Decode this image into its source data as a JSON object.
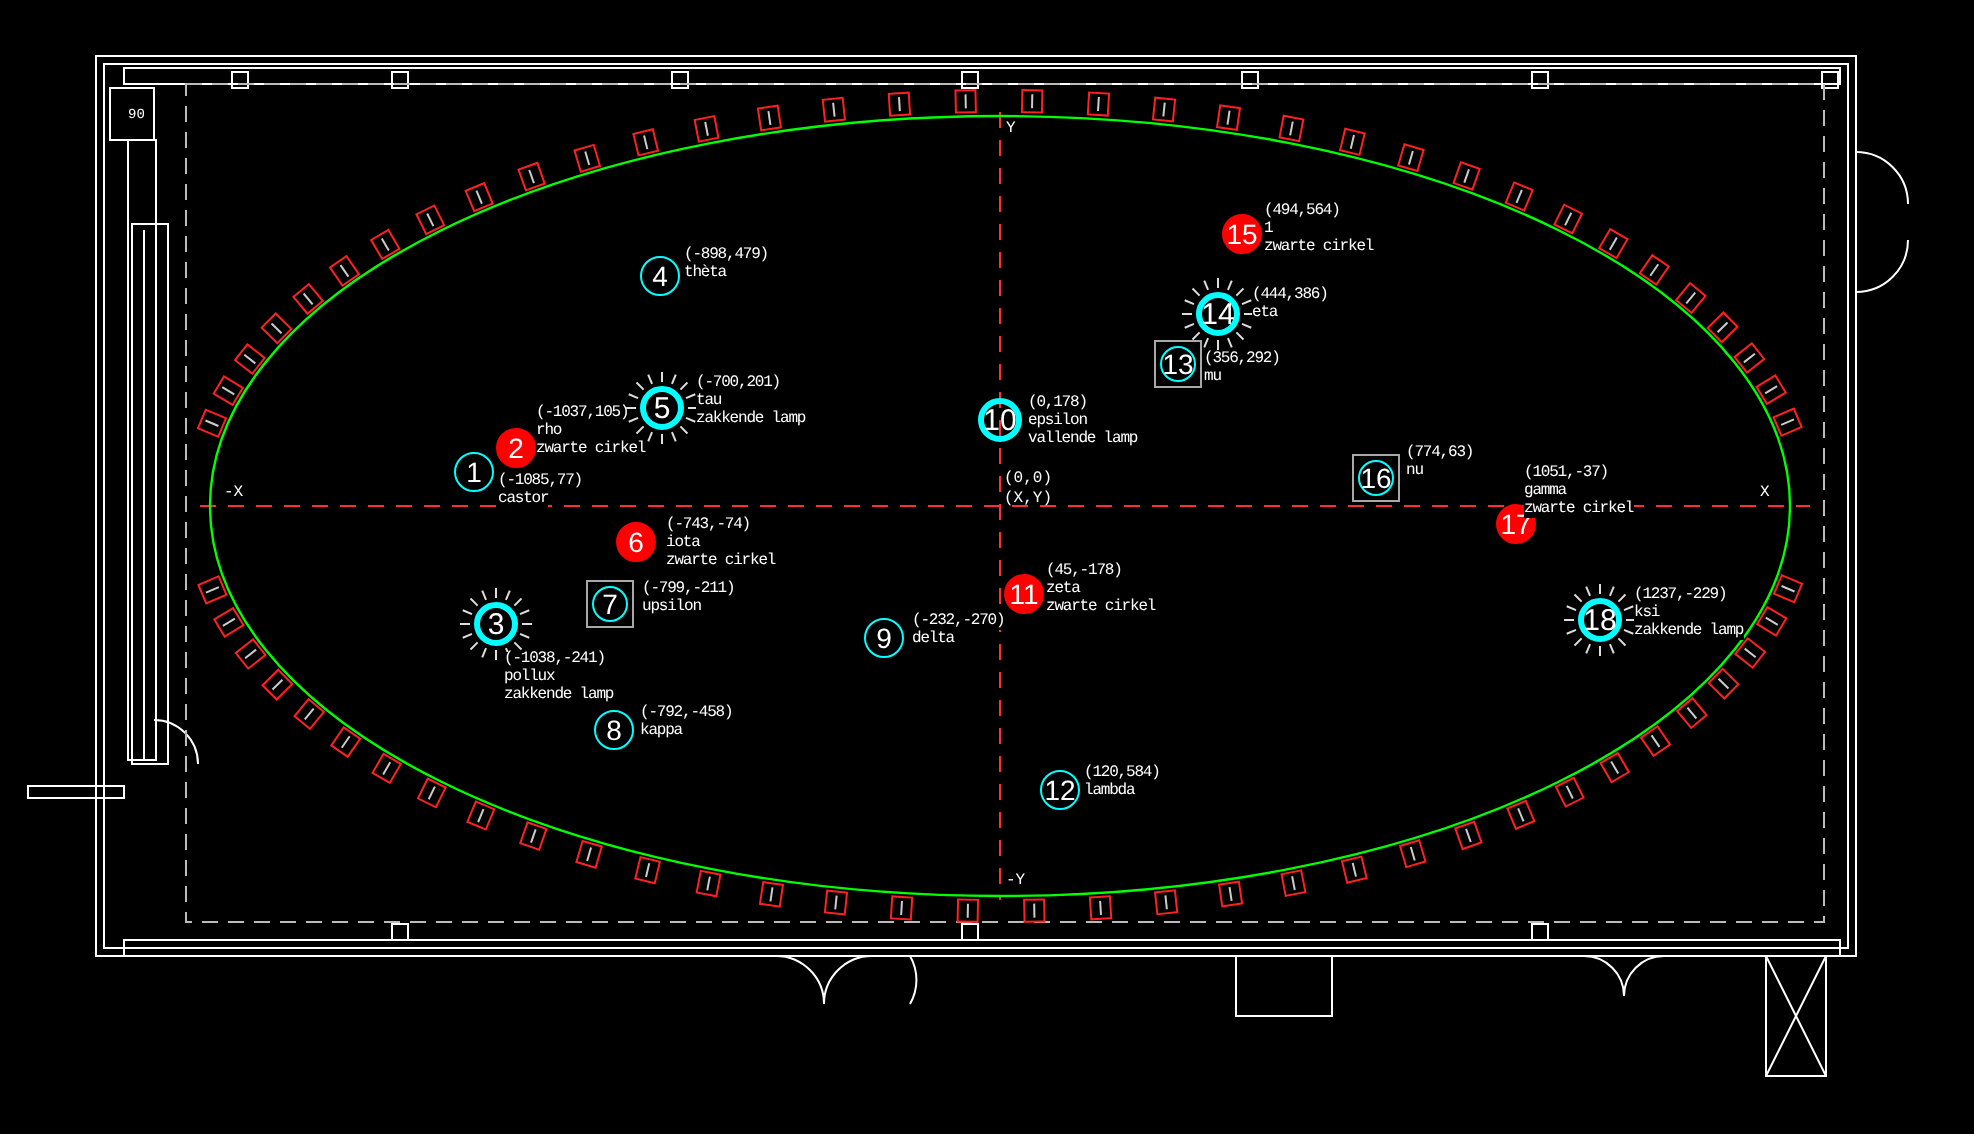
{
  "drawing": {
    "sheet_code": "90",
    "axes": {
      "y_top": "Y",
      "y_bottom": "-Y",
      "x_left": "-X",
      "x_right": "X",
      "origin": "(0,0)",
      "origin_legend": "(X,Y)"
    }
  },
  "markers": [
    {
      "number": "2",
      "kind": "filled",
      "coords": "(-1037,105)",
      "name": "rho",
      "note": "zwarte cirkel"
    },
    {
      "number": "1",
      "kind": "circle",
      "coords": "(-1085,77)",
      "name": "castor"
    },
    {
      "number": "3",
      "kind": "lamp",
      "coords": "(-1038,-241)",
      "name": "pollux",
      "note": "zakkende lamp"
    },
    {
      "number": "4",
      "kind": "circle",
      "coords": "(-898,479)",
      "name": "thèta"
    },
    {
      "number": "5",
      "kind": "lamp",
      "coords": "(-700,201)",
      "name": "tau",
      "note": "zakkende lamp"
    },
    {
      "number": "6",
      "kind": "filled",
      "coords": "(-743,-74)",
      "name": "iota",
      "note": "zwarte cirkel"
    },
    {
      "number": "7",
      "kind": "square",
      "coords": "(-799,-211)",
      "name": "upsilon"
    },
    {
      "number": "8",
      "kind": "circle",
      "coords": "(-792,-458)",
      "name": "kappa"
    },
    {
      "number": "9",
      "kind": "circle",
      "coords": "(-232,-270)",
      "name": "delta"
    },
    {
      "number": "10",
      "kind": "bold",
      "coords": "(0,178)",
      "name": "epsilon",
      "note": "vallende lamp"
    },
    {
      "number": "11",
      "kind": "filled",
      "coords": "(45,-178)",
      "name": "zeta",
      "note": "zwarte cirkel"
    },
    {
      "number": "12",
      "kind": "circle",
      "coords": "(120,584)",
      "name": "lambda"
    },
    {
      "number": "14",
      "kind": "lamp",
      "coords": "(444,386)",
      "name": "eta"
    },
    {
      "number": "13",
      "kind": "square",
      "coords": "(356,292)",
      "name": "mu"
    },
    {
      "number": "15",
      "kind": "filled",
      "coords": "(494,564)",
      "name": "1",
      "note": "zwarte cirkel"
    },
    {
      "number": "16",
      "kind": "square",
      "coords": "(774,63)",
      "name": "nu"
    },
    {
      "number": "17",
      "kind": "filled",
      "coords": "(1051,-37)",
      "name": "gamma",
      "note": "zwarte cirkel"
    },
    {
      "number": "18",
      "kind": "lamp",
      "coords": "(1237,-229)",
      "name": "ksi",
      "note": "zakkende lamp"
    }
  ]
}
